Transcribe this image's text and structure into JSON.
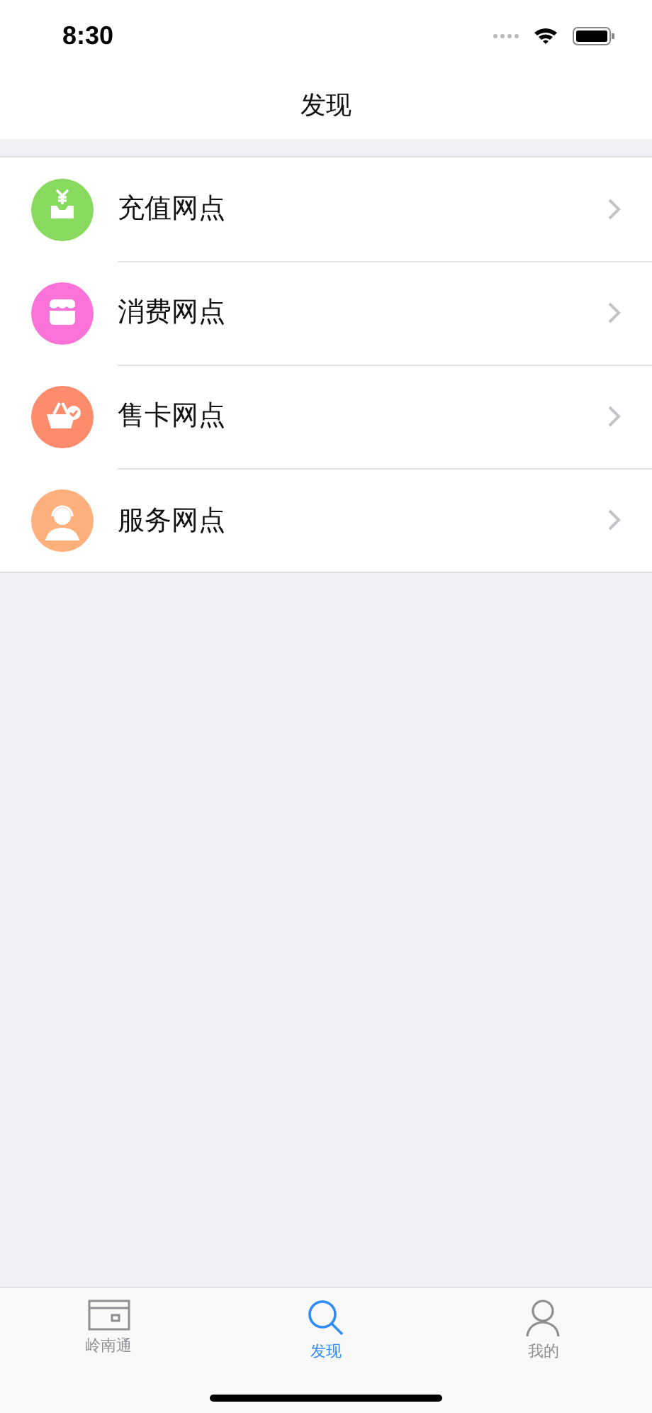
{
  "status_bar": {
    "time": "8:30"
  },
  "nav": {
    "title": "发现"
  },
  "items": [
    {
      "label": "充值网点",
      "color": "#88da5e"
    },
    {
      "label": "消费网点",
      "color": "#fb72d8"
    },
    {
      "label": "售卡网点",
      "color": "#fc8c6c"
    },
    {
      "label": "服务网点",
      "color": "#fdb07c"
    }
  ],
  "tabs": [
    {
      "label": "岭南通",
      "selected": false
    },
    {
      "label": "发现",
      "selected": true
    },
    {
      "label": "我的",
      "selected": false
    }
  ]
}
